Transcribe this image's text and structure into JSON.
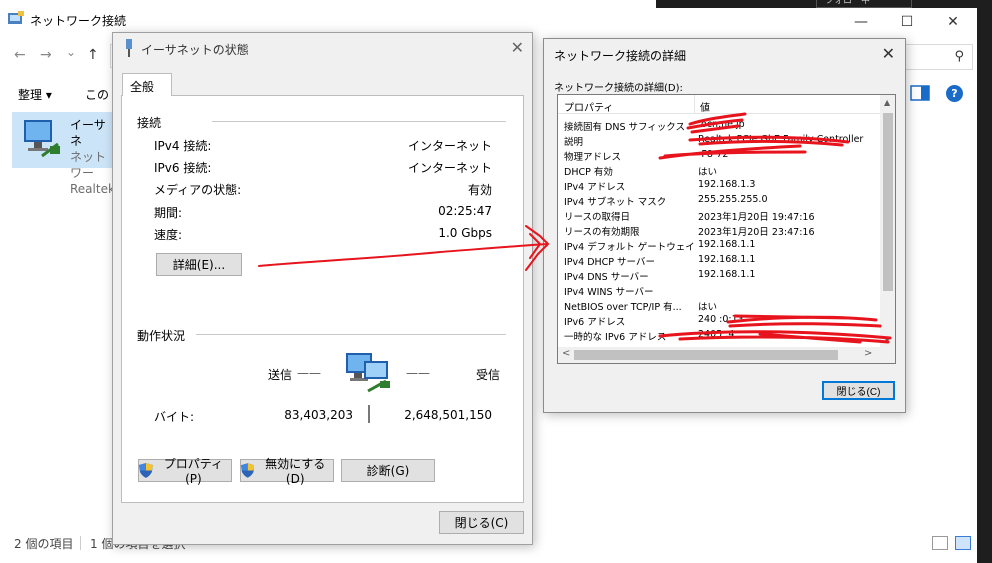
{
  "explorer": {
    "title": "ネットワーク接続",
    "toolbar": {
      "organize": "整理",
      "organize_arrow": "▾",
      "this_conn": "この"
    },
    "taskbar_tab": "フォロー中",
    "item": {
      "name": "イーサネ",
      "line2": "ネットワー",
      "line3": "Realtek"
    },
    "status": {
      "count": "2 個の項目",
      "selected": "1 個の項目を選択"
    },
    "icons": {
      "back": "arrow-left-icon",
      "forward": "arrow-right-icon",
      "up": "arrow-up-icon",
      "search": "search-icon",
      "help": "help-icon"
    },
    "glyphs": {
      "back": "←",
      "forward": "→",
      "dropdown": "⌄",
      "up": "↑",
      "minimize": "—",
      "maximize": "☐",
      "close": "✕",
      "search": "⚲",
      "help": "?"
    }
  },
  "status_dialog": {
    "title": "イーサネットの状態",
    "close_glyph": "✕",
    "tab_general": "全般",
    "connection_group": "接続",
    "rows": [
      {
        "label": "IPv4 接続:",
        "value": "インターネット"
      },
      {
        "label": "IPv6 接続:",
        "value": "インターネット"
      },
      {
        "label": "メディアの状態:",
        "value": "有効"
      },
      {
        "label": "期間:",
        "value": "02:25:47"
      },
      {
        "label": "速度:",
        "value": "1.0 Gbps"
      }
    ],
    "details_button": "詳細(E)...",
    "activity_group": "動作状況",
    "sent_label": "送信",
    "received_label": "受信",
    "dash": "——",
    "bytes_label": "バイト:",
    "bytes_sent": "83,403,203",
    "bytes_received": "2,648,501,150",
    "properties_button": "プロパティ(P)",
    "disable_button": "無効にする(D)",
    "diagnose_button": "診断(G)",
    "close_button": "閉じる(C)"
  },
  "details_dialog": {
    "title": "ネットワーク接続の詳細",
    "close_glyph": "✕",
    "list_label": "ネットワーク接続の詳細(D):",
    "col_property": "プロパティ",
    "col_value": "値",
    "rows": [
      {
        "property": "接続固有 DNS サフィックス",
        "value": "          .ocn.ne.jp"
      },
      {
        "property": "説明",
        "value": "Realtek PCIe GbE Family Controller"
      },
      {
        "property": "物理アドレス",
        "value": "               -F8-72"
      },
      {
        "property": "DHCP 有効",
        "value": "はい"
      },
      {
        "property": "IPv4 アドレス",
        "value": "192.168.1.3"
      },
      {
        "property": "IPv4 サブネット マスク",
        "value": "255.255.255.0"
      },
      {
        "property": "リースの取得日",
        "value": "2023年1月20日 19:47:16"
      },
      {
        "property": "リースの有効期限",
        "value": "2023年1月20日 23:47:16"
      },
      {
        "property": "IPv4 デフォルト ゲートウェイ",
        "value": "192.168.1.1"
      },
      {
        "property": "IPv4 DHCP サーバー",
        "value": "192.168.1.1"
      },
      {
        "property": "IPv4 DNS サーバー",
        "value": "192.168.1.1"
      },
      {
        "property": "IPv4 WINS サーバー",
        "value": ""
      },
      {
        "property": "NetBIOS over TCP/IP 有...",
        "value": "はい"
      },
      {
        "property": "IPv6 アドレス",
        "value": "240                          :0:13"
      },
      {
        "property": "一時的な IPv6 アドレス",
        "value": "2405             :4"
      }
    ],
    "close_button": "閉じる(C)",
    "scroll_glyphs": {
      "up": "▲",
      "down": "▼",
      "left": "<",
      "right": ">"
    }
  },
  "colors": {
    "annotation_red": "#e8141d",
    "selection_blue": "#cce4f7",
    "accent_blue": "#0078d7"
  }
}
